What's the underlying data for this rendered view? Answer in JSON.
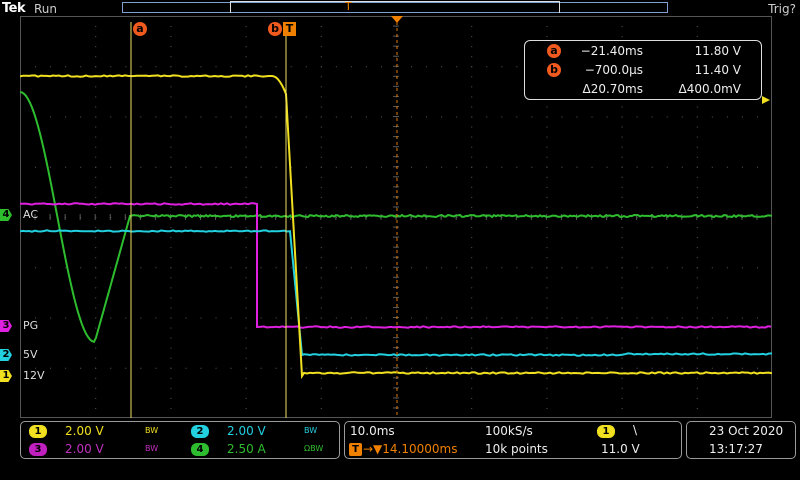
{
  "header": {
    "brand": "Tek",
    "acq_state": "Run",
    "trigger_state": "Trig?",
    "trigger_position_icon": "T",
    "trigger_marker_icon": "trigger-arrow-down-icon"
  },
  "cursors": {
    "a_label": "a",
    "b_label": "b",
    "trigger_label": "T"
  },
  "readout": {
    "rows": [
      {
        "badge": "a",
        "time": "−21.40ms",
        "value": "11.80 V"
      },
      {
        "badge": "b",
        "time": "−700.0µs",
        "value": "11.40 V"
      },
      {
        "badge": "",
        "time": "Δ20.70ms",
        "value": "Δ400.0mV"
      }
    ]
  },
  "channels": {
    "ch4": {
      "number": "4",
      "label": "AC",
      "color": "#2ebd2e"
    },
    "ch3": {
      "number": "3",
      "label": "PG",
      "color": "#e020e0"
    },
    "ch2": {
      "number": "2",
      "label": "5V",
      "color": "#22d0e0"
    },
    "ch1": {
      "number": "1",
      "label": "12V",
      "color": "#f0e020"
    }
  },
  "bottom": {
    "ch1_num": "1",
    "ch1_scale": "2.00 V",
    "ch1_bw": "BW",
    "ch2_num": "2",
    "ch2_scale": "2.00 V",
    "ch2_bw": "BW",
    "ch3_num": "3",
    "ch3_scale": "2.00 V",
    "ch3_bw": "BW",
    "ch4_num": "4",
    "ch4_scale": "2.50 A",
    "ch4_bw": "ΩBW",
    "timebase": "10.0ms",
    "sample_rate": "100kS/s",
    "trigger_delay": "→▼14.10000ms",
    "record_length": "10k points",
    "trig_source": "1",
    "trig_slope": "\\",
    "trig_level": "11.0 V",
    "date": "23 Oct  2020",
    "time": "13:17:27"
  }
}
